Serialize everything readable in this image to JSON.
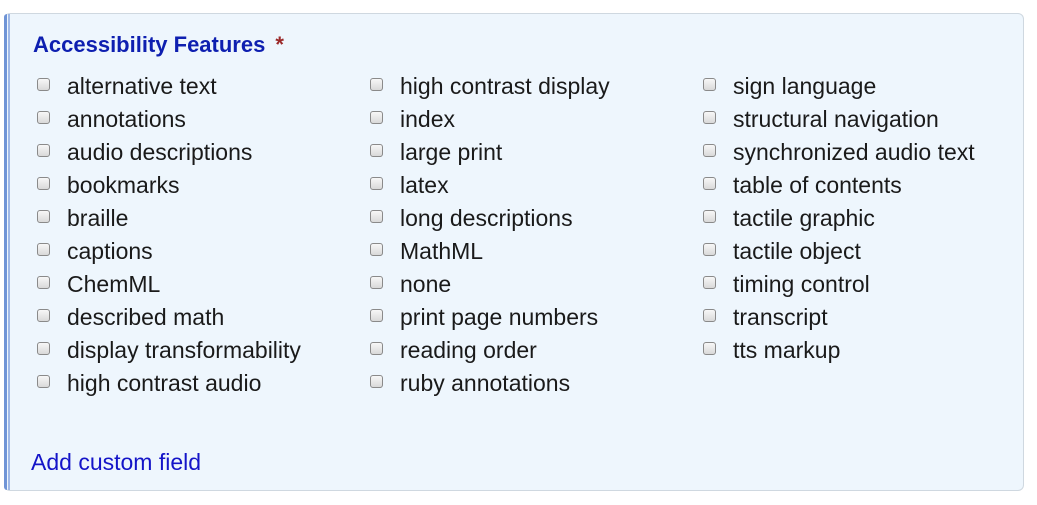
{
  "section": {
    "title": "Accessibility Features",
    "required_mark": "*",
    "add_link_label": "Add custom field"
  },
  "columns": [
    [
      "alternative text",
      "annotations",
      "audio descriptions",
      "bookmarks",
      "braille",
      "captions",
      "ChemML",
      "described math",
      "display transformability",
      "high contrast audio"
    ],
    [
      "high contrast display",
      "index",
      "large print",
      "latex",
      "long descriptions",
      "MathML",
      "none",
      "print page numbers",
      "reading order",
      "ruby annotations"
    ],
    [
      "sign language",
      "structural navigation",
      "synchronized audio text",
      "table of contents",
      "tactile graphic",
      "tactile object",
      "timing control",
      "transcript",
      "tts markup"
    ]
  ]
}
